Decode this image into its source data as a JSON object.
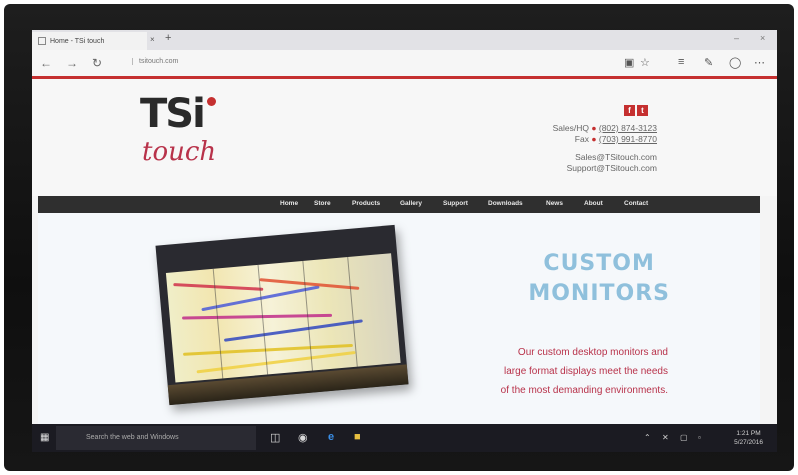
{
  "browser": {
    "tab_title": "Home - TSi touch",
    "address": "tsitouch.com",
    "new_tab_glyph": "+",
    "close_tab_glyph": "×",
    "window_controls": [
      "–",
      "×"
    ]
  },
  "site": {
    "logo_word": "TSi",
    "logo_script": "touch",
    "social": [
      "f",
      "t"
    ],
    "contact": {
      "sales_label": "Sales/HQ",
      "sales_phone": "(802) 874-3123",
      "fax_label": "Fax",
      "fax_phone": "(703) 991-8770",
      "sales_email": "Sales@TSitouch.com",
      "support_email": "Support@TSitouch.com"
    },
    "nav": [
      "Home",
      "Store",
      "Products",
      "Gallery",
      "Support",
      "Downloads",
      "News",
      "About",
      "Contact"
    ],
    "hero": {
      "title_line1": "CUSTOM",
      "title_line2": "MONITORS",
      "text_line1": "Our custom desktop monitors and",
      "text_line2": "large format displays meet the needs",
      "text_line3": "of the most demanding environments."
    }
  },
  "taskbar": {
    "search_placeholder": "Search the web and Windows",
    "time": "1:21 PM",
    "date": "5/27/2016"
  },
  "colors": {
    "accent_red": "#c53030",
    "logo_magenta": "#b8324a",
    "hero_blue": "#8fc0dc",
    "nav_dark": "#2f2f2f"
  },
  "icons": [
    "tab-favicon-icon",
    "back-arrow-icon",
    "forward-arrow-icon",
    "refresh-icon",
    "reading-view-icon",
    "favorite-star-icon",
    "hub-icon",
    "web-note-icon",
    "share-icon",
    "more-icon",
    "facebook-icon",
    "twitter-icon",
    "windows-start-icon",
    "task-view-icon",
    "edge-icon",
    "file-explorer-icon",
    "store-icon"
  ]
}
